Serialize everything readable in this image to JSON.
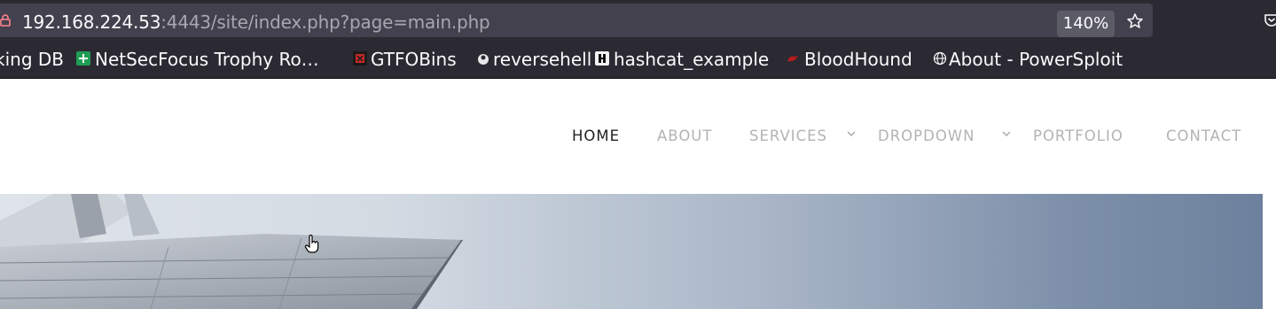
{
  "browser": {
    "url_host": "192.168.224.53",
    "url_rest": ":4443/site/index.php?page=main.php",
    "zoom": "140%",
    "icons": [
      "lock-icon",
      "star-icon",
      "pocket-icon"
    ]
  },
  "bookmarks": [
    {
      "label": "king DB",
      "icon": "none"
    },
    {
      "label": "NetSecFocus Trophy Ro…",
      "icon": "green-plus-favicon"
    },
    {
      "label": "GTFOBins",
      "icon": "red-box-favicon"
    },
    {
      "label": "reversehell",
      "icon": "shell-favicon"
    },
    {
      "label": "hashcat_example",
      "icon": "hashcat-favicon"
    },
    {
      "label": "BloodHound",
      "icon": "bloodhound-favicon"
    },
    {
      "label": "About - PowerSploit",
      "icon": "globe-icon"
    }
  ],
  "nav": {
    "items": [
      {
        "label": "HOME",
        "active": true,
        "dropdown": false
      },
      {
        "label": "ABOUT",
        "active": false,
        "dropdown": false
      },
      {
        "label": "SERVICES",
        "active": false,
        "dropdown": true
      },
      {
        "label": "DROPDOWN",
        "active": false,
        "dropdown": true
      },
      {
        "label": "PORTFOLIO",
        "active": false,
        "dropdown": false
      },
      {
        "label": "CONTACT",
        "active": false,
        "dropdown": false
      }
    ]
  },
  "colors": {
    "chrome_bg": "#2b2a33",
    "urlbar_bg": "#42414d",
    "nav_active": "#222222",
    "nav_inactive": "#b3b3b3"
  }
}
